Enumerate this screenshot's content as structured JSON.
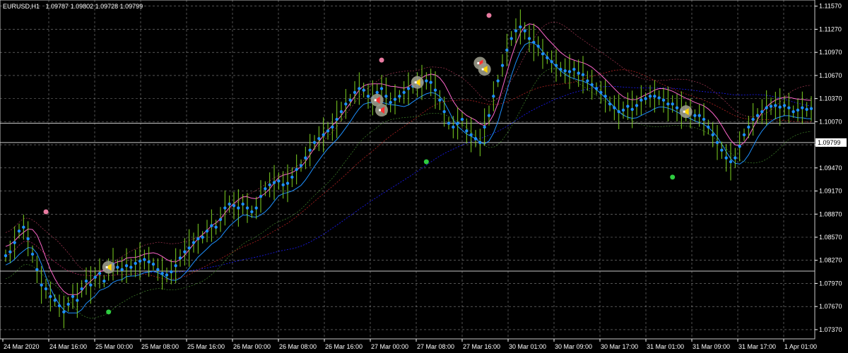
{
  "header": {
    "symbol": "EURUSD,H1",
    "ohlc": "1.09787 1.09802 1.09728 1.09799"
  },
  "current_price": "1.09799",
  "colors": {
    "background": "#000000",
    "grid": "#c0c0c0",
    "candle": "#7ed321",
    "dots": "#1e90ff",
    "upper_band": "#ff66cc",
    "lower_band": "#1e90ff",
    "ma_red": "#b22222",
    "ma_blue": "#1c1cff",
    "pink_dot": "#e87aa0",
    "green_dot": "#2ecc40",
    "hline": "#c8c8c8"
  },
  "chart_data": {
    "type": "line",
    "ylim": [
      1.0725,
      1.1165
    ],
    "x_tick_labels": [
      "24 Mar 2020",
      "24 Mar 16:00",
      "25 Mar 00:00",
      "25 Mar 08:00",
      "25 Mar 16:00",
      "26 Mar 00:00",
      "26 Mar 08:00",
      "26 Mar 16:00",
      "27 Mar 00:00",
      "27 Mar 08:00",
      "27 Mar 16:00",
      "30 Mar 01:00",
      "30 Mar 09:00",
      "30 Mar 17:00",
      "31 Mar 01:00",
      "31 Mar 09:00",
      "31 Mar 17:00",
      "1 Apr 01:00"
    ],
    "y_tick_labels": [
      "1.11570",
      "1.11270",
      "1.10970",
      "1.10670",
      "1.10370",
      "1.10070",
      "1.09770",
      "1.09470",
      "1.09170",
      "1.08870",
      "1.08570",
      "1.08270",
      "1.07970",
      "1.07670",
      "1.07370"
    ],
    "y_tick_values": [
      1.1157,
      1.1127,
      1.1097,
      1.1067,
      1.1037,
      1.1007,
      1.0977,
      1.0947,
      1.0917,
      1.0887,
      1.0857,
      1.0827,
      1.0797,
      1.0767,
      1.0737
    ],
    "horizontal_lines": [
      1.1005,
      1.098,
      1.0813
    ],
    "close_series": [
      1.0833,
      1.0838,
      1.085,
      1.0865,
      1.087,
      1.0855,
      1.0835,
      1.0815,
      1.0795,
      1.079,
      1.078,
      1.0775,
      1.0768,
      1.076,
      1.077,
      1.078,
      1.0775,
      1.079,
      1.08,
      1.0795,
      1.0805,
      1.081,
      1.08,
      1.0815,
      1.0822,
      1.0818,
      1.0815,
      1.082,
      1.0818,
      1.0823,
      1.0826,
      1.0828,
      1.0825,
      1.0822,
      1.0815,
      1.081,
      1.0808,
      1.0812,
      1.082,
      1.083,
      1.0838,
      1.0843,
      1.085,
      1.0855,
      1.0857,
      1.0865,
      1.0872,
      1.087,
      1.088,
      1.0895,
      1.09,
      1.0898,
      1.0895,
      1.09,
      1.0895,
      1.089,
      1.0895,
      1.091,
      1.092,
      1.0925,
      1.0928,
      1.093,
      1.0925,
      1.0927,
      1.0935,
      1.0945,
      1.095,
      1.096,
      1.097,
      1.098,
      1.0985,
      1.099,
      1.0995,
      1.1,
      1.101,
      1.102,
      1.103,
      1.1035,
      1.1045,
      1.105,
      1.1048,
      1.104,
      1.1038,
      1.1045,
      1.105,
      1.104,
      1.1032,
      1.1036,
      1.104,
      1.1045,
      1.105,
      1.1053,
      1.1055,
      1.1058,
      1.106,
      1.1058,
      1.1048,
      1.1035,
      1.102,
      1.1005,
      1.1,
      1.1005,
      1.101,
      1.0995,
      1.099,
      1.0985,
      1.098,
      1.1,
      1.1015,
      1.104,
      1.106,
      1.108,
      1.11,
      1.1115,
      1.1125,
      1.113,
      1.1125,
      1.1115,
      1.111,
      1.1105,
      1.1095,
      1.109,
      1.1085,
      1.108,
      1.1075,
      1.1073,
      1.1072,
      1.1075,
      1.107,
      1.1068,
      1.106,
      1.1055,
      1.105,
      1.1045,
      1.104,
      1.103,
      1.1025,
      1.102,
      1.1022,
      1.1027,
      1.1023,
      1.1028,
      1.1035,
      1.1037,
      1.104,
      1.104,
      1.1038,
      1.1035,
      1.103,
      1.103,
      1.1025,
      1.1022,
      1.102,
      1.1018,
      1.1015,
      1.1015,
      1.101,
      1.1,
      1.099,
      1.098,
      1.097,
      1.096,
      1.0955,
      1.096,
      1.0975,
      1.099,
      1.1,
      1.101,
      1.1015,
      1.102,
      1.1025,
      1.1027,
      1.1028,
      1.1026,
      1.1028,
      1.1025,
      1.102,
      1.1022,
      1.1025,
      1.1023,
      1.1024
    ],
    "signals": [
      {
        "index": 23,
        "price": 1.0818,
        "kind": "buy"
      },
      {
        "index": 83,
        "price": 1.1035,
        "kind": "sell"
      },
      {
        "index": 84,
        "price": 1.1022,
        "kind": "sell"
      },
      {
        "index": 92,
        "price": 1.1058,
        "kind": "buy"
      },
      {
        "index": 106,
        "price": 1.1083,
        "kind": "sell"
      },
      {
        "index": 107,
        "price": 1.1075,
        "kind": "buy"
      },
      {
        "index": 152,
        "price": 1.102,
        "kind": "buy"
      }
    ],
    "pink_dots": [
      {
        "index": 9,
        "price": 1.089
      },
      {
        "index": 84,
        "price": 1.1087
      },
      {
        "index": 108,
        "price": 1.1145
      }
    ],
    "green_dots": [
      {
        "index": 23,
        "price": 1.076
      },
      {
        "index": 94,
        "price": 1.0955
      },
      {
        "index": 149,
        "price": 1.0935
      }
    ]
  }
}
